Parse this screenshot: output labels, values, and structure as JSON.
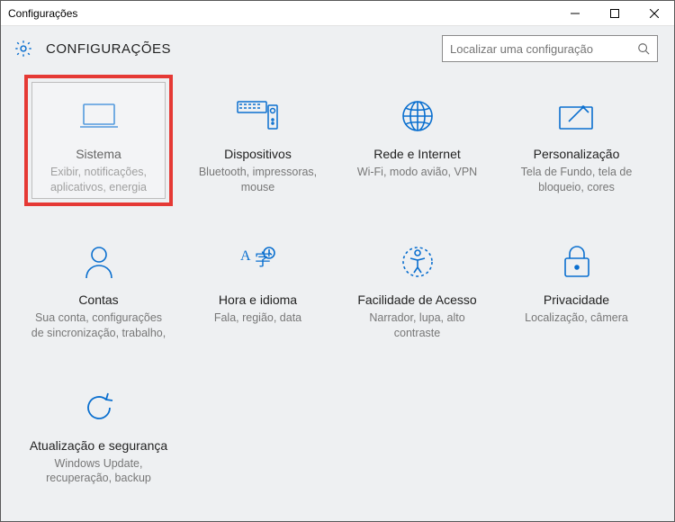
{
  "window": {
    "title": "Configurações"
  },
  "header": {
    "page_title": "CONFIGURAÇÕES"
  },
  "search": {
    "placeholder": "Localizar uma configuração"
  },
  "tiles": {
    "system": {
      "title": "Sistema",
      "desc": "Exibir, notificações, aplicativos, energia"
    },
    "devices": {
      "title": "Dispositivos",
      "desc": "Bluetooth, impressoras, mouse"
    },
    "network": {
      "title": "Rede e Internet",
      "desc": "Wi-Fi, modo avião, VPN"
    },
    "personal": {
      "title": "Personalização",
      "desc": "Tela de Fundo, tela de bloqueio, cores"
    },
    "accounts": {
      "title": "Contas",
      "desc": "Sua conta, configurações de sincronização, trabalho,"
    },
    "time": {
      "title": "Hora e idioma",
      "desc": "Fala, região, data"
    },
    "ease": {
      "title": "Facilidade de Acesso",
      "desc": "Narrador, lupa, alto contraste"
    },
    "privacy": {
      "title": "Privacidade",
      "desc": "Localização, câmera"
    },
    "update": {
      "title": "Atualização e segurança",
      "desc": "Windows Update, recuperação, backup"
    }
  }
}
